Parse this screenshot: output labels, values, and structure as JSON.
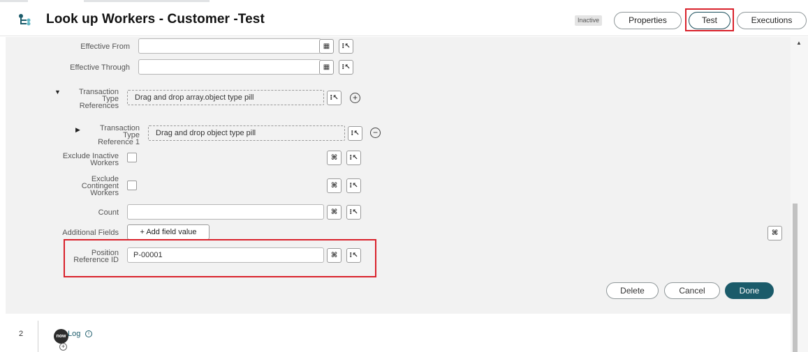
{
  "header": {
    "title": "Look up Workers - Customer -Test",
    "status_badge": "Inactive",
    "properties_label": "Properties",
    "test_label": "Test",
    "executions_label": "Executions"
  },
  "form": {
    "effective_from": {
      "label": "Effective From",
      "value": ""
    },
    "effective_through": {
      "label": "Effective Through",
      "value": ""
    },
    "transaction_type_references": {
      "label_lines": [
        "Transaction",
        "Type",
        "References"
      ],
      "placeholder": "Drag and drop array.object type pill"
    },
    "transaction_type_reference_1": {
      "label_lines": [
        "Transaction",
        "Type",
        "Reference 1"
      ],
      "placeholder": "Drag and drop object type pill"
    },
    "exclude_inactive_workers": {
      "label_lines": [
        "Exclude Inactive",
        "Workers"
      ],
      "checked": false
    },
    "exclude_contingent_workers": {
      "label_lines": [
        "Exclude",
        "Contingent",
        "Workers"
      ],
      "checked": false
    },
    "count": {
      "label": "Count",
      "value": ""
    },
    "additional_fields": {
      "label": "Additional Fields",
      "button_label": "+ Add field value"
    },
    "position_reference_id": {
      "label_lines": [
        "Position",
        "Reference ID"
      ],
      "value": "P-00001"
    }
  },
  "actions": {
    "delete": "Delete",
    "cancel": "Cancel",
    "done": "Done"
  },
  "steps": [
    {
      "number": "2",
      "badge": "now",
      "label": "Log"
    }
  ],
  "icons": {
    "calendar": "calendar-icon",
    "data_pill_picker": "data-pill-picker-icon",
    "script_toggle": "script-toggle-icon",
    "add_circle": "plus-circle-icon",
    "remove_circle": "minus-circle-icon"
  },
  "colors": {
    "accent": "#1b5b6a",
    "highlight_box": "#d9212b",
    "panel_bg": "#f2f2f2"
  }
}
